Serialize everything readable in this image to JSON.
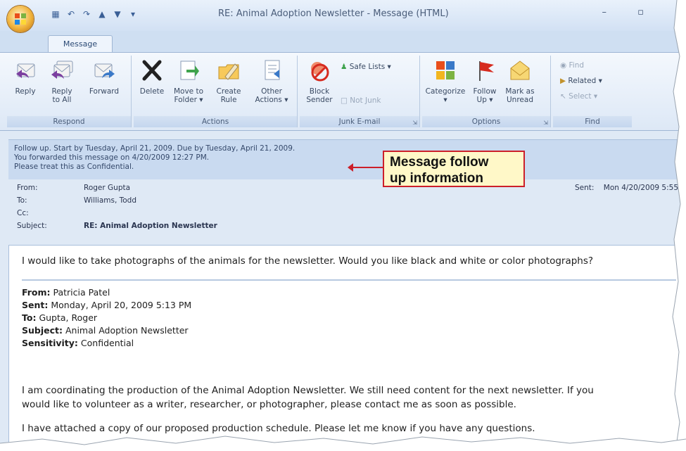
{
  "window": {
    "title": "RE: Animal Adoption Newsletter - Message (HTML)",
    "controls": "– ▫"
  },
  "tabs": [
    {
      "label": "Message"
    }
  ],
  "ribbon": {
    "respond": {
      "label": "Respond",
      "buttons": [
        {
          "label1": "Reply",
          "label2": ""
        },
        {
          "label1": "Reply",
          "label2": "to All"
        },
        {
          "label1": "Forward",
          "label2": ""
        }
      ]
    },
    "actions": {
      "label": "Actions",
      "buttons": [
        {
          "label1": "Delete",
          "label2": ""
        },
        {
          "label1": "Move to",
          "label2": "Folder ▾"
        },
        {
          "label1": "Create",
          "label2": "Rule"
        },
        {
          "label1": "Other",
          "label2": "Actions ▾"
        }
      ]
    },
    "junk": {
      "label": "Junk E-mail",
      "block1": "Block",
      "block2": "Sender",
      "safe_lists": "Safe Lists ▾",
      "not_junk": "Not Junk"
    },
    "options": {
      "label": "Options",
      "buttons": [
        {
          "label1": "Categorize",
          "label2": "▾"
        },
        {
          "label1": "Follow",
          "label2": "Up ▾"
        },
        {
          "label1": "Mark as",
          "label2": "Unread"
        }
      ]
    },
    "find": {
      "label": "Find",
      "find": "Find",
      "related": "Related ▾",
      "select": "Select ▾"
    }
  },
  "infobar": {
    "line1": "Follow up.  Start by Tuesday, April 21, 2009.  Due by Tuesday, April 21, 2009.",
    "line2": "You forwarded this message on 4/20/2009 12:27 PM.",
    "line3": "Please treat this as Confidential."
  },
  "headers": {
    "from_label": "From:",
    "from_value": "Roger Gupta",
    "to_label": "To:",
    "to_value": "Williams, Todd",
    "cc_label": "Cc:",
    "cc_value": "",
    "subject_label": "Subject:",
    "subject_value": "RE: Animal Adoption Newsletter",
    "sent_label": "Sent:",
    "sent_value": "Mon 4/20/2009 5:55"
  },
  "body": {
    "reply": "I would like to take photographs of the animals for the newsletter. Would you like black and white or color photographs?",
    "quoted": {
      "from_label": "From:",
      "from": "Patricia Patel",
      "sent_label": "Sent:",
      "sent": "Monday, April 20, 2009 5:13 PM",
      "to_label": "To:",
      "to": "Gupta, Roger",
      "subject_label": "Subject:",
      "subject": "Animal Adoption Newsletter",
      "sensitivity_label": "Sensitivity:",
      "sensitivity": "Confidential"
    },
    "para1_line1": "I am coordinating the production of the Animal Adoption Newsletter. We still need content for the next newsletter. If you",
    "para1_line2": "would like to volunteer as a writer, researcher, or photographer, please contact me as soon as possible.",
    "para2": "I have attached a copy of our proposed production schedule. Please let me know if you have any questions."
  },
  "callout": {
    "line1": "Message follow",
    "line2": "up information"
  },
  "colors": {
    "callout_border": "#cc1f2a",
    "callout_fill": "#fff8c8",
    "infobar": "#c9daf0"
  }
}
